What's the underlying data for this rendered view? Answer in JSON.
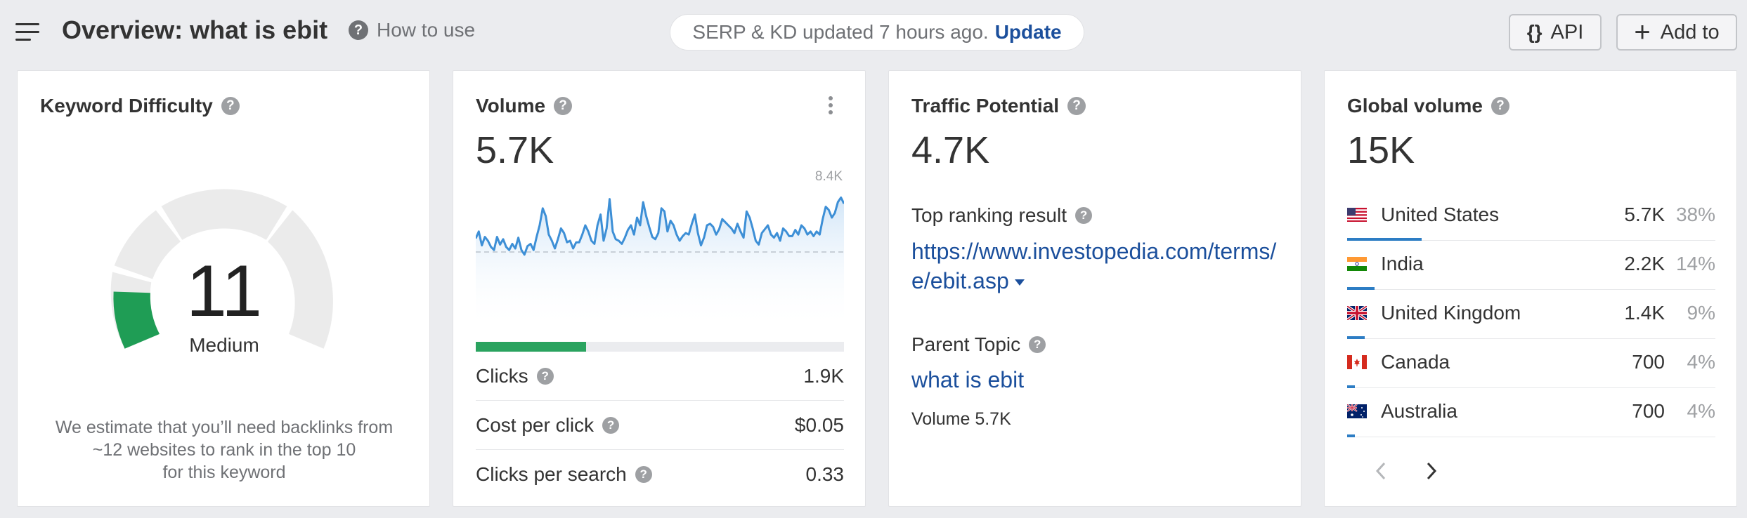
{
  "header": {
    "title": "Overview: what is ebit",
    "how_to_use": "How to use",
    "update_status": "SERP & KD updated 7 hours ago.",
    "update_link": "Update",
    "api_label": "API",
    "add_to_label": "Add to"
  },
  "kd": {
    "title": "Keyword Difficulty",
    "value": "11",
    "score": 11,
    "level": "Medium",
    "note": "We estimate that you’ll need backlinks from\n~12 websites to rank in the top 10\nfor this keyword",
    "accent_color": "#1f9d55"
  },
  "volume": {
    "title": "Volume",
    "value": "5.7K",
    "max_label": "8.4K",
    "clicks_share": 0.3,
    "progress_color": "#2aa35f",
    "line_color": "#3d8fd6",
    "trend": [
      43,
      52,
      34,
      45,
      40,
      32,
      28,
      45,
      35,
      42,
      32,
      28,
      36,
      30,
      44,
      28,
      22,
      33,
      36,
      28,
      45,
      60,
      82,
      72,
      48,
      40,
      30,
      42,
      56,
      50,
      38,
      40,
      30,
      38,
      38,
      48,
      60,
      52,
      40,
      36,
      60,
      74,
      40,
      56,
      94,
      52,
      42,
      40,
      36,
      44,
      54,
      60,
      48,
      70,
      60,
      90,
      72,
      58,
      45,
      42,
      50,
      82,
      78,
      52,
      66,
      60,
      48,
      40,
      46,
      50,
      48,
      62,
      74,
      50,
      34,
      44,
      60,
      62,
      58,
      48,
      55,
      68,
      64,
      60,
      56,
      50,
      62,
      52,
      44,
      78,
      70,
      56,
      40,
      35,
      50,
      55,
      60,
      48,
      44,
      50,
      40,
      56,
      52,
      46,
      46,
      54,
      48,
      60,
      56,
      48,
      52,
      46,
      52,
      48,
      68,
      84,
      80,
      70,
      76,
      90,
      96,
      88
    ]
  },
  "metrics": [
    {
      "label": "Clicks",
      "value": "1.9K"
    },
    {
      "label": "Cost per click",
      "value": "$0.05"
    },
    {
      "label": "Clicks per search",
      "value": "0.33"
    }
  ],
  "traffic": {
    "title": "Traffic Potential",
    "value": "4.7K",
    "top_result_label": "Top ranking result",
    "top_result_url": "https://www.investopedia.com/terms/e/ebit.asp",
    "parent_topic_label": "Parent Topic",
    "parent_topic": "what is ebit",
    "parent_volume": "Volume 5.7K"
  },
  "global": {
    "title": "Global volume",
    "value": "15K",
    "bar_color": "#2d7dc4",
    "countries": [
      {
        "name": "United States",
        "volume": "5.7K",
        "pct": "38%",
        "share": 0.38,
        "flag": "us-flag-icon"
      },
      {
        "name": "India",
        "volume": "2.2K",
        "pct": "14%",
        "share": 0.14,
        "flag": "india-flag-icon"
      },
      {
        "name": "United Kingdom",
        "volume": "1.4K",
        "pct": "9%",
        "share": 0.09,
        "flag": "uk-flag-icon"
      },
      {
        "name": "Canada",
        "volume": "700",
        "pct": "4%",
        "share": 0.04,
        "flag": "canada-flag-icon"
      },
      {
        "name": "Australia",
        "volume": "700",
        "pct": "4%",
        "share": 0.04,
        "flag": "australia-flag-icon"
      }
    ]
  }
}
